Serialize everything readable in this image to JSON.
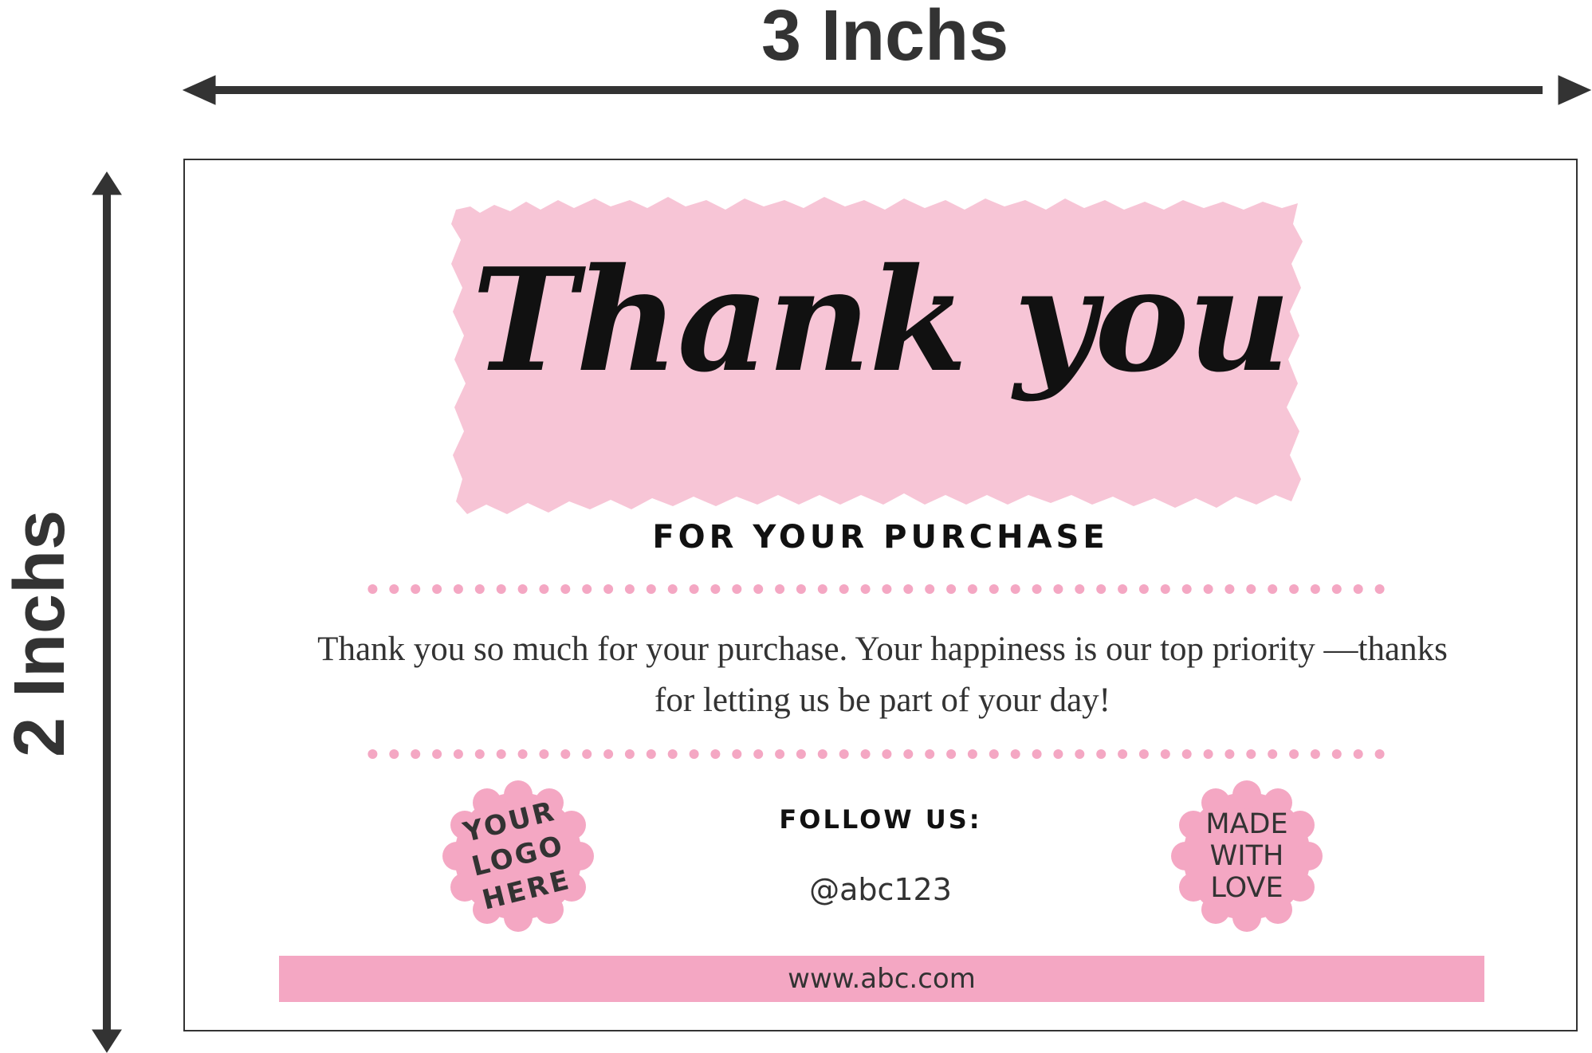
{
  "dimensions": {
    "width_label": "3 Inchs",
    "height_label": "2 Inchs"
  },
  "card": {
    "headline": "Thank you",
    "subheadline": "FOR YOUR PURCHASE",
    "message": "Thank you so much for your purchase. Your happiness is our top priority —thanks for letting us be part of your day!",
    "logo_badge": {
      "line1": "YOUR",
      "line2": "LOGO",
      "line3": "HERE"
    },
    "follow_title": "FOLLOW US:",
    "social_handle": "@abc123",
    "made_badge": {
      "line1": "MADE",
      "line2": "WITH",
      "line3": "LOVE"
    },
    "website": "www.abc.com"
  },
  "colors": {
    "accent_pink": "#f4a7c3",
    "brush_pink": "#f7c5d6",
    "dark_text": "#333333",
    "dimension_gray": "#333333"
  },
  "icons": {
    "width_arrow": "double-headed-horizontal-arrow",
    "height_arrow": "double-headed-vertical-arrow"
  }
}
